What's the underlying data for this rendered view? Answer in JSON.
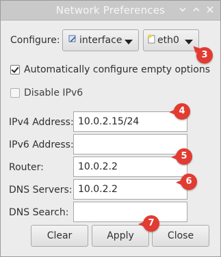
{
  "window": {
    "title": "Network Preferences",
    "controls": [
      "chevron-down",
      "chevron-up",
      "close"
    ]
  },
  "configure": {
    "label": "Configure:",
    "type_value": "interface",
    "device_value": "eth0"
  },
  "options": {
    "auto_configure": {
      "label": "Automatically configure empty options",
      "checked": true
    },
    "disable_ipv6": {
      "label": "Disable IPv6",
      "checked": false
    }
  },
  "fields": {
    "ipv4": {
      "label": "IPv4 Address:",
      "value": "10.0.2.15/24"
    },
    "ipv6": {
      "label": "IPv6 Address:",
      "value": ""
    },
    "router": {
      "label": "Router:",
      "value": "10.0.2.2"
    },
    "dns_servers": {
      "label": "DNS Servers:",
      "value": "10.0.2.2"
    },
    "dns_search": {
      "label": "DNS Search:",
      "value": ""
    }
  },
  "buttons": {
    "clear": "Clear",
    "apply": "Apply",
    "close": "Close"
  },
  "annotations": {
    "b3": "3",
    "b4": "4",
    "b5": "5",
    "b6": "6",
    "b7": "7"
  },
  "colors": {
    "annotation": "#e23b32",
    "titlebar": "#c9c9c9",
    "window_bg": "#ececec"
  }
}
